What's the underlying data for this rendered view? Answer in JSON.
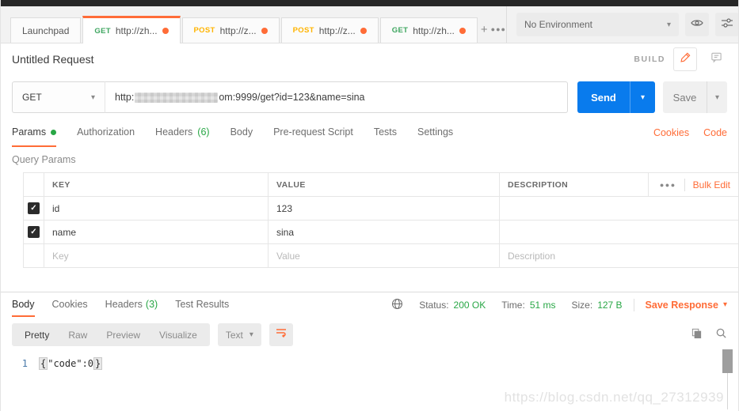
{
  "colors": {
    "accent_orange": "#ff6c37",
    "method_get_green": "#3da55f",
    "method_post_yellow": "#ffb400",
    "status_green": "#29a746",
    "send_blue": "#097bed",
    "checkbox_black": "#2b2b2b"
  },
  "icons": {
    "caret_down": "▾",
    "plus": "+",
    "more_dots": "●●●",
    "header_more_dots": "●●●",
    "check": "✓"
  },
  "tab_bar": {
    "tabs": [
      {
        "method": "",
        "label": "Launchpad"
      },
      {
        "method": "GET",
        "label": "http://zh..."
      },
      {
        "method": "POST",
        "label": "http://z..."
      },
      {
        "method": "POST",
        "label": "http://z..."
      },
      {
        "method": "GET",
        "label": "http://zh..."
      }
    ],
    "environment_selected": "No Environment"
  },
  "request": {
    "title": "Untitled Request",
    "build_label": "BUILD",
    "method_selected": "GET",
    "url_visible_prefix": "http:",
    "url_visible_suffix": "om:9999/get?id=123&name=sina",
    "send_label": "Send",
    "save_label": "Save",
    "tabs": {
      "params": "Params",
      "authorization": "Authorization",
      "headers": "Headers",
      "headers_count": "(6)",
      "body": "Body",
      "prerequest": "Pre-request Script",
      "tests": "Tests",
      "settings": "Settings"
    },
    "cookies_link": "Cookies",
    "code_link": "Code",
    "query_params_title": "Query Params"
  },
  "params_table": {
    "headers": {
      "key": "KEY",
      "value": "VALUE",
      "description": "DESCRIPTION"
    },
    "bulk_edit_label": "Bulk Edit",
    "rows": [
      {
        "key": "id",
        "value": "123",
        "description": ""
      },
      {
        "key": "name",
        "value": "sina",
        "description": ""
      }
    ],
    "placeholder_row": {
      "key": "Key",
      "value": "Value",
      "description": "Description"
    }
  },
  "response": {
    "tabs": {
      "body": "Body",
      "cookies": "Cookies",
      "headers": "Headers",
      "headers_count": "(3)",
      "test_results": "Test Results"
    },
    "meta": {
      "status_label": "Status:",
      "status_value": "200 OK",
      "time_label": "Time:",
      "time_value": "51 ms",
      "size_label": "Size:",
      "size_value": "127 B"
    },
    "save_response_label": "Save Response",
    "toolbar": {
      "pretty": "Pretty",
      "raw": "Raw",
      "preview": "Preview",
      "visualize": "Visualize",
      "format_selected": "Text"
    },
    "body": {
      "line_number": "1",
      "open_brace": "{",
      "content": "\"code\":0",
      "close_brace": "}"
    }
  },
  "watermark": "https://blog.csdn.net/qq_27312939"
}
